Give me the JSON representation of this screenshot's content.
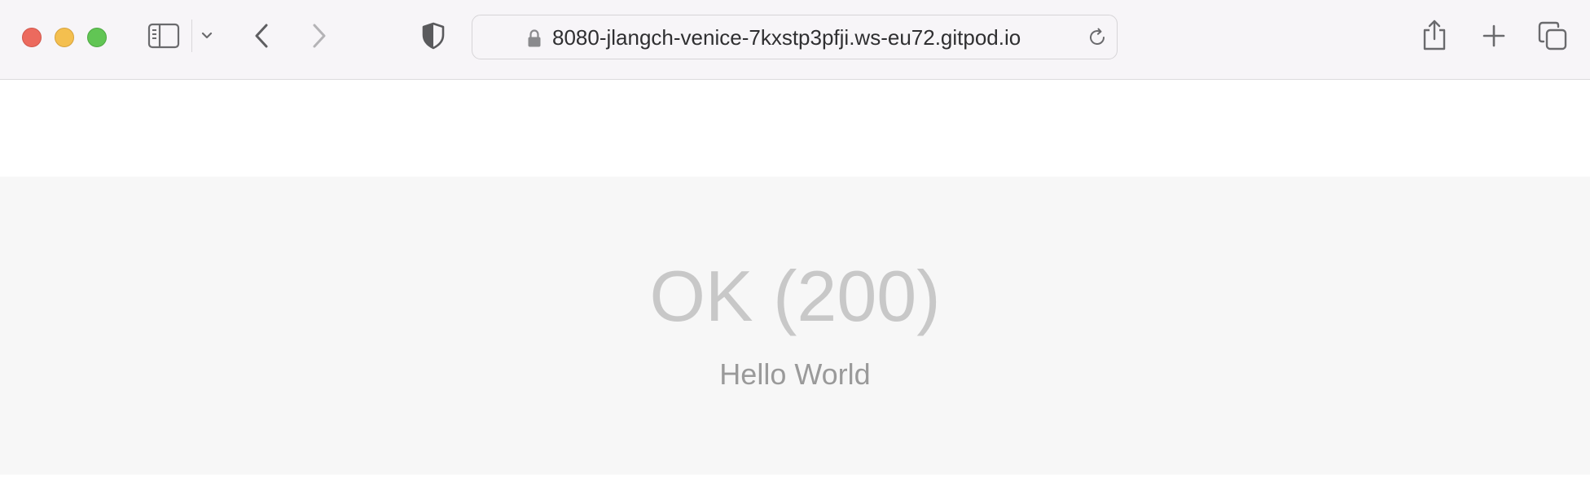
{
  "browser": {
    "url": "8080-jlangch-venice-7kxstp3pfji.ws-eu72.gitpod.io",
    "toolbar_icons": [
      "sidebar-icon",
      "chevron-down-icon",
      "back-icon",
      "forward-icon",
      "shield-icon",
      "lock-icon",
      "reload-icon",
      "share-icon",
      "plus-icon",
      "tabs-icon"
    ],
    "traffic_lights": {
      "close": "#ec6a5e",
      "minimize": "#f4bf4f",
      "maximize": "#61c554"
    }
  },
  "page": {
    "status": "OK (200)",
    "message": "Hello World"
  }
}
